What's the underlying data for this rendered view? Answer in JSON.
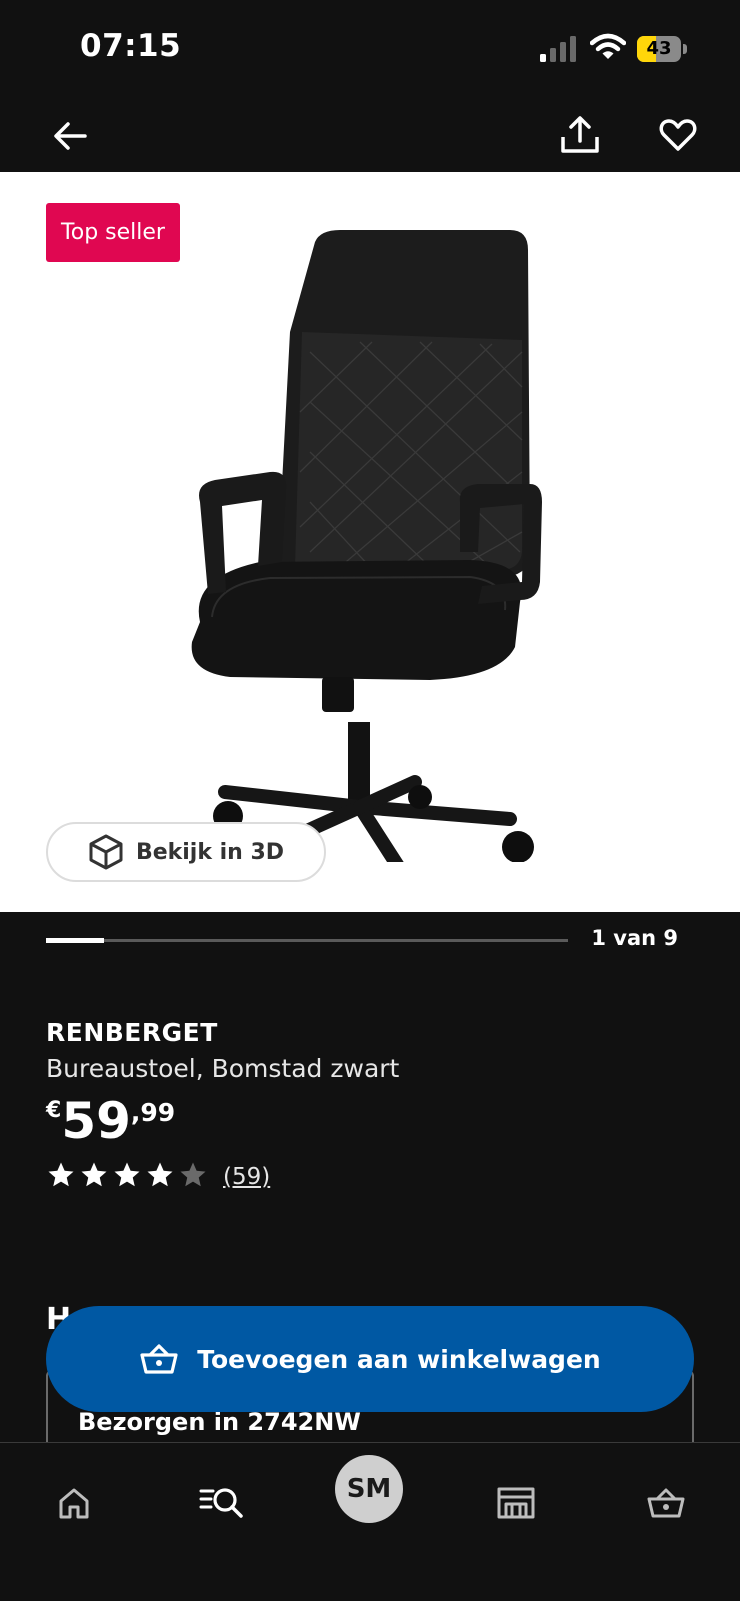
{
  "status_bar": {
    "time": "07:15",
    "battery_level": "43",
    "battery_fraction": 0.43,
    "signal_bars_active": 1,
    "signal_bars_total": 4,
    "battery_color": "#ffd60a"
  },
  "header": {
    "back_icon": "arrow-left-icon",
    "share_icon": "share-icon",
    "favorite_icon": "heart-outline-icon"
  },
  "gallery": {
    "badge": "Top seller",
    "badge_color": "#e00751",
    "view_3d_label": "Bekijk in 3D",
    "view_3d_icon": "cube-icon",
    "counter": "1 van 9",
    "progress_fraction": 0.111
  },
  "product": {
    "name": "RENBERGET",
    "description": "Bureaustoel, Bomstad zwart",
    "price": {
      "currency": "€",
      "integer": "59",
      "decimal": ",99"
    },
    "rating": {
      "stars": 4,
      "max": 5,
      "review_count": "(59)"
    }
  },
  "delivery": {
    "section_heading_partial": "H",
    "text": "Bezorgen in 2742NW"
  },
  "cta": {
    "label": "Toevoegen aan winkelwagen",
    "icon": "basket-icon",
    "color": "#0058a3"
  },
  "tab_bar": {
    "items": [
      {
        "icon": "home-icon"
      },
      {
        "icon": "search-list-icon"
      },
      {
        "icon": "avatar",
        "label": "SM"
      },
      {
        "icon": "store-icon"
      },
      {
        "icon": "basket-icon"
      }
    ]
  }
}
